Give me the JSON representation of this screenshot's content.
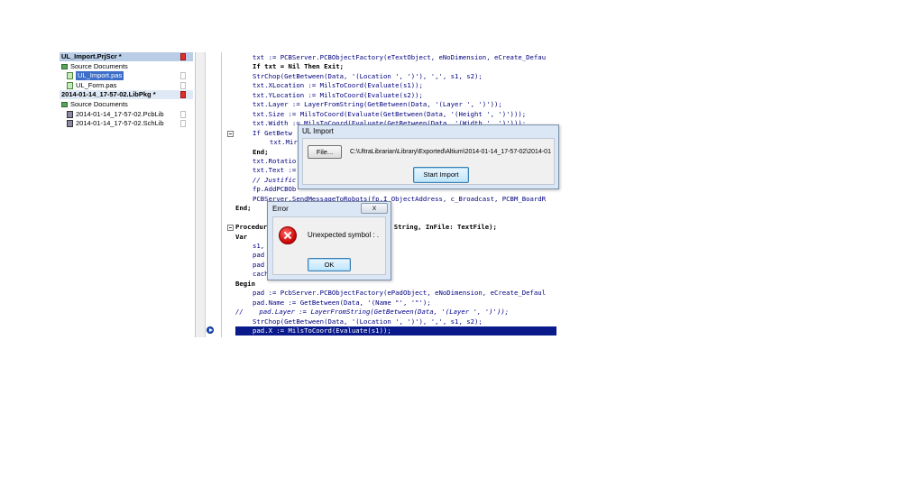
{
  "project_tree": {
    "items": [
      {
        "label": "UL_Import.PrjScr *",
        "type": "header"
      },
      {
        "label": "Source Documents",
        "type": "folder"
      },
      {
        "label": "UL_Import.pas",
        "type": "file",
        "selected": true
      },
      {
        "label": "UL_Form.pas",
        "type": "file"
      },
      {
        "label": "2014-01-14_17-57-02.LibPkg *",
        "type": "header"
      },
      {
        "label": "Source Documents",
        "type": "folder"
      },
      {
        "label": "2014-01-14_17-57-02.PcbLib",
        "type": "file"
      },
      {
        "label": "2014-01-14_17-57-02.SchLib",
        "type": "file"
      }
    ]
  },
  "code": {
    "lines": [
      {
        "text": "txt := PCBServer.PCBObjectFactory(eTextObject, eNoDimension, eCreate_Defau",
        "indent": 1,
        "style": "blue"
      },
      {
        "text": "If txt = Nil Then Exit;",
        "indent": 1,
        "style": "kw"
      },
      {
        "text": "StrChop(GetBetween(Data, '(Location ', ')'), ',', s1, s2);",
        "indent": 1,
        "style": "blue"
      },
      {
        "text": "txt.XLocation := MilsToCoord(Evaluate(s1));",
        "indent": 1,
        "style": "blue"
      },
      {
        "text": "txt.YLocation := MilsToCoord(Evaluate(s2));",
        "indent": 1,
        "style": "blue"
      },
      {
        "text": "txt.Layer := LayerFromString(GetBetween(Data, '(Layer ', ')'));",
        "indent": 1,
        "style": "blue"
      },
      {
        "text": "txt.Size := MilsToCoord(Evaluate(GetBetween(Data, '(Height ', ')')));",
        "indent": 1,
        "style": "blue"
      },
      {
        "text": "txt.Width := MilsToCoord(Evaluate(GetBetween(Data, '(Width ', ')')));",
        "indent": 1,
        "style": "blue"
      },
      {
        "text": "If GetBetw",
        "indent": 1,
        "style": "blue"
      },
      {
        "text": "txt.Mir",
        "indent": 2,
        "style": "blue"
      },
      {
        "text": "End;",
        "indent": 1,
        "style": "kw"
      },
      {
        "text": "txt.Rotatio",
        "indent": 1,
        "style": "blue"
      },
      {
        "text": "txt.Text :=",
        "indent": 1,
        "style": "blue"
      },
      {
        "text": "// Justific",
        "indent": 1,
        "style": "comment"
      },
      {
        "text": "fp.AddPCBOb",
        "indent": 1,
        "style": "blue"
      },
      {
        "text": "PCBServer.SendMessageToRobots(fp.I_ObjectAddress, c_Broadcast, PCBM_BoardR",
        "indent": 1,
        "style": "blue"
      },
      {
        "text": "End;",
        "indent": 0,
        "style": "kw"
      },
      {
        "text": "",
        "indent": 0,
        "style": "blue"
      },
      {
        "text": "Procedure                       , Data: String, InFile: TextFile);",
        "indent": 0,
        "style": "kw"
      },
      {
        "text": "Var",
        "indent": 0,
        "style": "kw"
      },
      {
        "text": "s1,",
        "indent": 1,
        "style": "blue"
      },
      {
        "text": "pad",
        "indent": 1,
        "style": "blue"
      },
      {
        "text": "pad",
        "indent": 1,
        "style": "blue"
      },
      {
        "text": "cach",
        "indent": 1,
        "style": "blue"
      },
      {
        "text": "Begin",
        "indent": 0,
        "style": "kw"
      },
      {
        "text": "pad := PcbServer.PCBObjectFactory(ePadObject, eNoDimension, eCreate_Defaul",
        "indent": 1,
        "style": "blue"
      },
      {
        "text": "pad.Name := GetBetween(Data, '(Name \"', '\"');",
        "indent": 1,
        "style": "blue"
      },
      {
        "text": "//    pad.Layer := LayerFromString(GetBetween(Data, '(Layer ', ')'));",
        "indent": 0,
        "style": "comment"
      },
      {
        "text": "StrChop(GetBetween(Data, '(Location ', ')'), ',', s1, s2);",
        "indent": 1,
        "style": "blue"
      },
      {
        "text": "pad.X := MilsToCoord(Evaluate(s1));",
        "indent": 1,
        "style": "hl"
      }
    ]
  },
  "ul_import_dialog": {
    "title": "UL Import",
    "file_button": "File...",
    "path": "C:\\UltraLibrarian\\Library\\Exported\\Altium\\2014-01-14_17-57-02\\2014-01",
    "start_button": "Start Import"
  },
  "error_dialog": {
    "title": "Error",
    "close_label": "x",
    "message": "Unexpected symbol : .",
    "ok_button": "OK"
  }
}
